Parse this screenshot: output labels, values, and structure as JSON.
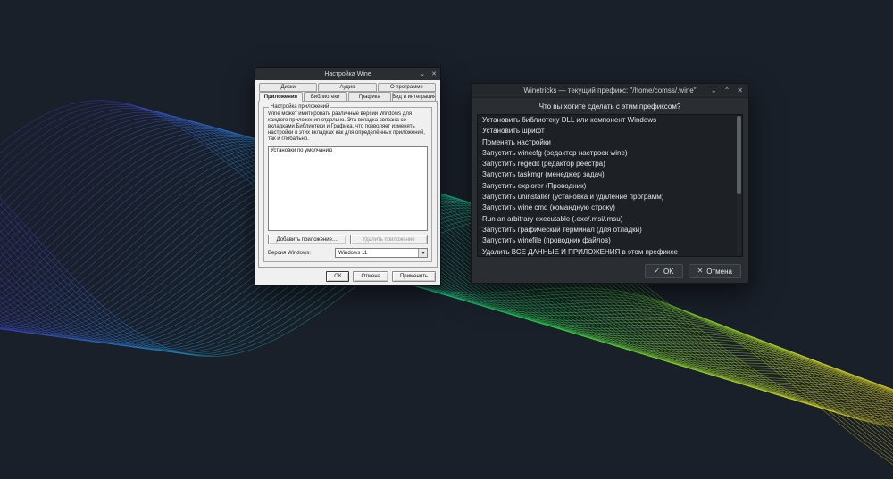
{
  "wallpaper": {
    "background": "#1a202a",
    "gradient": [
      "#6a1fb0",
      "#4a3ae0",
      "#2f7bea",
      "#19b8d8",
      "#17d89a",
      "#2ee24e",
      "#8ee62e",
      "#d8e62a",
      "#f0d020"
    ]
  },
  "wine_config": {
    "title": "Настройка Wine",
    "controls": {
      "minimize": "⌄",
      "close": "✕"
    },
    "tabs_row1": [
      "Диски",
      "Аудио",
      "О программе"
    ],
    "tabs_row2": [
      "Приложения",
      "Библиотеки",
      "Графика",
      "Вид и интеграция"
    ],
    "active_tab": "Приложения",
    "group_title": "Настройка приложений",
    "description": "Wine может имитировать различные версии Windows для каждого приложения отдельно. Эта вкладка связана со вкладками Библиотеки и Графика, что позволяет изменять настройки в этих вкладках как для определённых приложений, так и глобально.",
    "list_items": [
      "Установки по умолчанию"
    ],
    "add_button": "Добавить приложение…",
    "remove_button": "Удалить приложение",
    "windows_version_label": "Версия Windows:",
    "windows_version_value": "Windows 11",
    "ok": "ОК",
    "cancel": "Отмена",
    "apply": "Применить"
  },
  "winetricks": {
    "title": "Winetricks — текущий префикс: \"/home/comss/.wine\"",
    "controls": {
      "minimize": "⌄",
      "maximize": "⌃",
      "close": "✕"
    },
    "question": "Что вы хотите сделать с этим префиксом?",
    "items": [
      "Установить библиотеку DLL или компонент Windows",
      "Установить шрифт",
      "Поменять настройки",
      "Запустить winecfg (редактор настроек wine)",
      "Запустить regedit (редактор реестра)",
      "Запустить taskmgr (менеджер задач)",
      "Запустить explorer (Проводник)",
      "Запустить uninstaller (установка и удаление программ)",
      "Запустить wine cmd (командную строку)",
      "Run an arbitrary executable (.exe/.msi/.msu)",
      "Запустить графический терминал (для отладки)",
      "Запустить winefile (проводник файлов)",
      "Удалить ВСЕ ДАННЫЕ И ПРИЛОЖЕНИЯ в этом префиксе"
    ],
    "ok_icon": "✓",
    "ok": "OK",
    "cancel_icon": "✕",
    "cancel": "Отмена"
  }
}
